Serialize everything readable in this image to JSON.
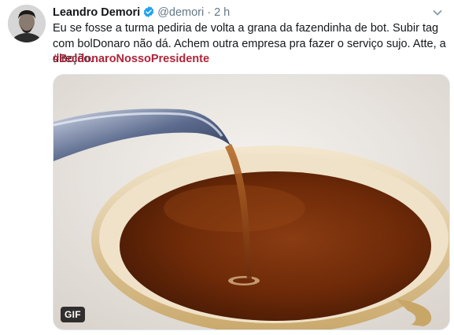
{
  "tweet": {
    "author_name": "Leandro Demori",
    "handle": "@demori",
    "separator": "·",
    "time": "2 h",
    "text": "Eu se fosse a turma pediria de volta a grana da fazendinha de bot. Subir tag com bolDonaro não dá. Achem outra empresa pra fazer o serviço sujo. Atte, a direção.",
    "hashtag": "#BoldonaroNossoPresidente",
    "media": {
      "badge": "GIF"
    }
  },
  "icons": {
    "verified": "verified-badge-icon",
    "more": "chevron-down-icon"
  },
  "colors": {
    "hashtag": "#b0243a",
    "verified": "#1da1f2",
    "secondary_text": "#657786"
  }
}
